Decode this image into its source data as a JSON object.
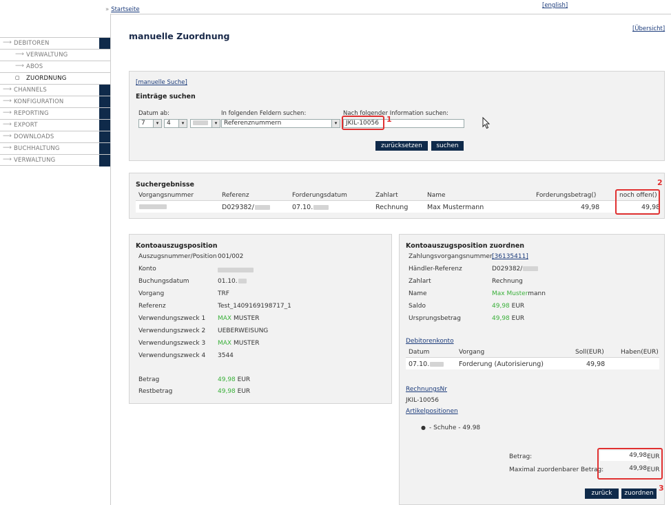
{
  "header": {
    "breadcrumb_sep": "»",
    "breadcrumb": "Startseite",
    "language_link": "[english]"
  },
  "sidebar": {
    "items": [
      {
        "label": "DEBITOREN"
      },
      {
        "label": "VERWALTUNG"
      },
      {
        "label": "ABOS"
      },
      {
        "label": "ZUORDNUNG"
      },
      {
        "label": "CHANNELS"
      },
      {
        "label": "KONFIGURATION"
      },
      {
        "label": "REPORTING"
      },
      {
        "label": "EXPORT"
      },
      {
        "label": "DOWNLOADS"
      },
      {
        "label": "BUCHHALTUNG"
      },
      {
        "label": "VERWALTUNG"
      }
    ]
  },
  "page": {
    "title": "manuelle Zuordnung",
    "overview_link": "[Übersicht]"
  },
  "search": {
    "manual_search_link": "[manuelle Suche]",
    "heading": "Einträge suchen",
    "date_label": "Datum ab:",
    "day_value": "7",
    "month_value": "4",
    "fields_label": "In folgenden Feldern suchen:",
    "field_value": "Referenznummern",
    "info_label": "Nach folgender Information suchen:",
    "info_value": "JKIL-10056",
    "reset_button": "zurücksetzen",
    "search_button": "suchen",
    "marker": "1"
  },
  "results": {
    "heading": "Suchergebnisse",
    "columns": [
      "Vorgangsnummer",
      "Referenz",
      "Forderungsdatum",
      "Zahlart",
      "Name",
      "Forderungsbetrag()",
      "noch offen()"
    ],
    "row": {
      "referenz": "D029382/",
      "datum": "07.10.",
      "zahlart": "Rechnung",
      "name": "Max Mustermann",
      "betrag": "49,98",
      "offen": "49,98"
    },
    "marker": "2"
  },
  "kontoauszug": {
    "heading": "Kontoauszugsposition",
    "rows": [
      {
        "label": "Auszugsnummer/Position",
        "value": "001/002"
      },
      {
        "label": "Konto",
        "value": ""
      },
      {
        "label": "Buchungsdatum",
        "value": "01.10."
      },
      {
        "label": "Vorgang",
        "value": "TRF"
      },
      {
        "label": "Referenz",
        "value": "Test_1409169198717_1"
      },
      {
        "label": "Verwendungszweck 1",
        "value_green": "MAX",
        "value": "MUSTER"
      },
      {
        "label": "Verwendungszweck 2",
        "value": "UEBERWEISUNG"
      },
      {
        "label": "Verwendungszweck 3",
        "value_green": "MAX",
        "value": "MUSTER"
      },
      {
        "label": "Verwendungszweck 4",
        "value": "3544"
      }
    ],
    "betrag_label": "Betrag",
    "betrag_value": "49,98",
    "betrag_unit": "EUR",
    "rest_label": "Restbetrag",
    "rest_value": "49,98",
    "rest_unit": "EUR"
  },
  "zuordnen": {
    "heading": "Kontoauszugsposition zuordnen",
    "zahlungsvorgang_label": "Zahlungsvorgangsnummer",
    "zahlungsvorgang_value": "[36135411]",
    "haendler_label": "Händler-Referenz",
    "haendler_value": "D029382/",
    "zahlart_label": "Zahlart",
    "zahlart_value": "Rechnung",
    "name_label": "Name",
    "name_green": "Max Muster",
    "name_rest": "mann",
    "saldo_label": "Saldo",
    "saldo_value": "49,98",
    "saldo_unit": "EUR",
    "ursprung_label": "Ursprungsbetrag",
    "ursprung_value": "49,98",
    "ursprung_unit": "EUR",
    "debitorenkonto_link": "Debitorenkonto",
    "deb_columns": [
      "Datum",
      "Vorgang",
      "Soll(EUR)",
      "Haben(EUR)"
    ],
    "deb_row": {
      "datum": "07.10.",
      "vorgang": "Forderung (Autorisierung)",
      "soll": "49,98",
      "haben": ""
    },
    "rechnungsnr_link": "RechnungsNr",
    "rechnungsnr_value": "JKIL-10056",
    "artikel_link": "Artikelpositionen",
    "artikel_item": "- Schuhe - 49.98",
    "betrag_label": "Betrag:",
    "betrag_value": "49,98",
    "betrag_unit": "EUR",
    "max_label": "Maximal zuordenbarer Betrag:",
    "max_value": "49,98",
    "max_unit": "EUR",
    "back_button": "zurück",
    "assign_button": "zuordnen",
    "marker": "3"
  },
  "colors": {
    "accent": "#0f2a4a",
    "highlight": "#e03030",
    "green": "#3ab03a"
  }
}
